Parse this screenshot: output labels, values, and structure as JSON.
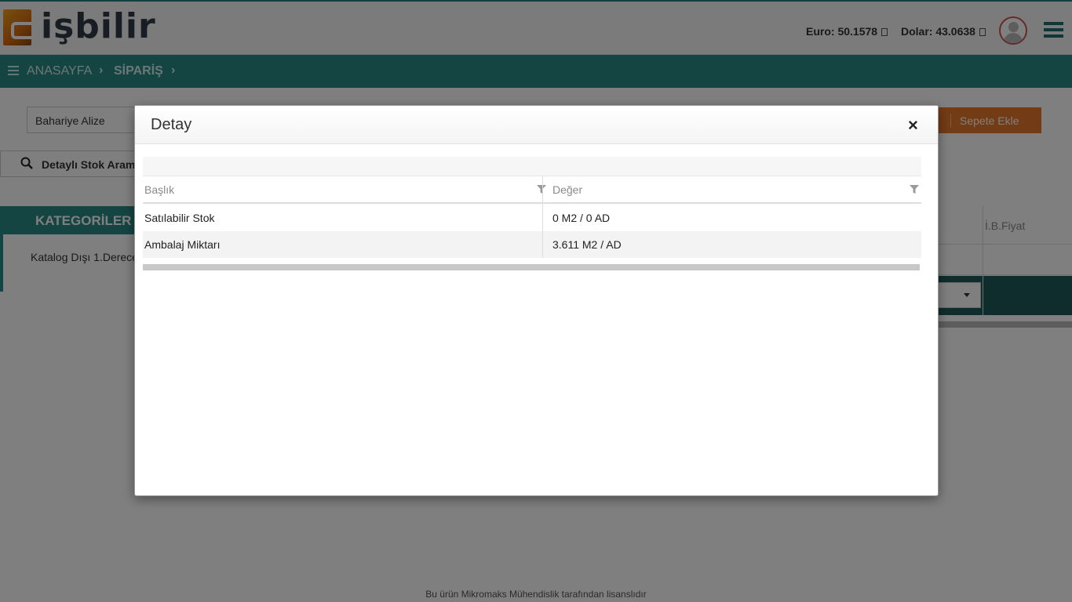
{
  "header": {
    "logo_text": "işbilir",
    "euro_rate": "Euro: 50.1578",
    "dollar_rate": "Dolar: 43.0638"
  },
  "breadcrumb": {
    "home": "ANASAYFA",
    "current": "SİPARİŞ"
  },
  "page": {
    "customer_value": "Bahariye Alize",
    "detailed_search_label": "Detaylı Stok Aram",
    "add_to_cart_label": "Sepete Ekle",
    "categories_title": "KATEGORİLER",
    "category_item": "Katalog Dışı 1.Derece",
    "grid_column_price": "İ.B.Fiyat",
    "footer_text": "Bu ürün Mikromaks Mühendislik tarafından lisanslıdır"
  },
  "modal": {
    "title": "Detay",
    "close_label": "×",
    "columns": [
      "Başlık",
      "Değer"
    ],
    "rows": [
      {
        "label": "Satılabilir Stok",
        "value": "0 M2 / 0 AD"
      },
      {
        "label": "Ambalaj Miktarı",
        "value": "3.611 M2 / AD"
      }
    ]
  },
  "colors": {
    "brand_teal": "#2b8a87",
    "accent_orange": "#e5782c"
  }
}
